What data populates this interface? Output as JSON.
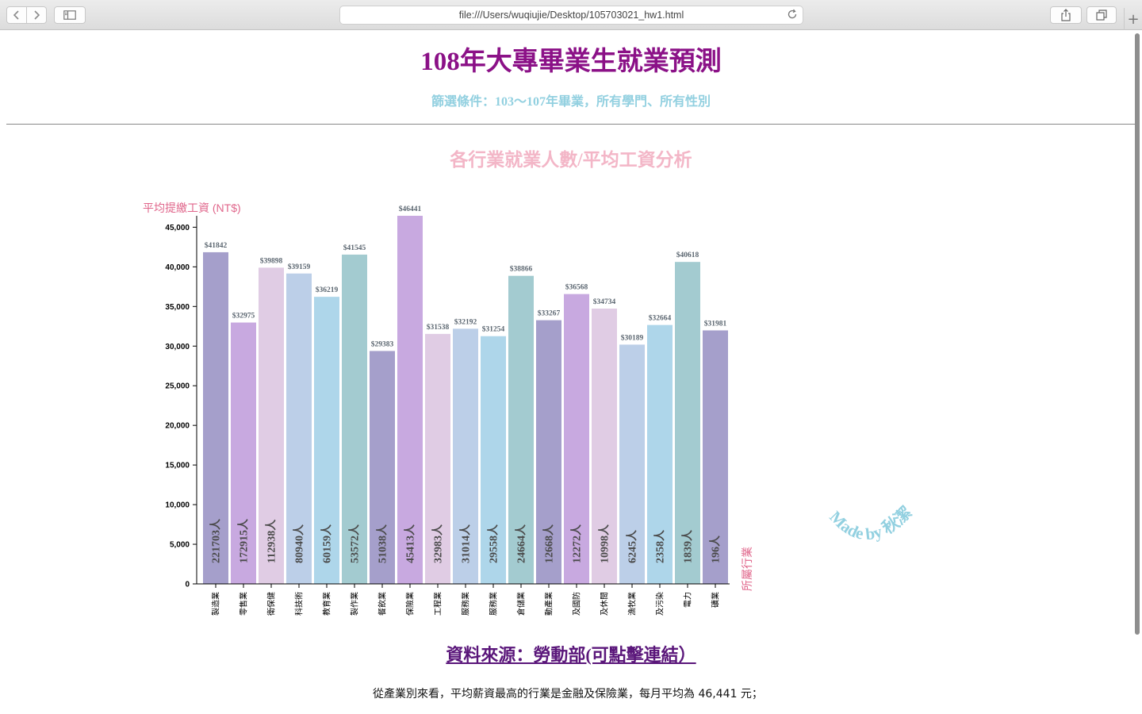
{
  "browser": {
    "url": "file:///Users/wuqiujie/Desktop/105703021_hw1.html"
  },
  "page": {
    "title": "108年大專畢業生就業預測",
    "subtitle": "篩選條件：103～107年畢業，所有學門、所有性別",
    "chart_heading": "各行業就業人數/平均工資分析",
    "watermark": "Made by 秋潔",
    "source_link": "資料來源：勞動部(可點擊連結）",
    "summary": "從產業別來看，平均薪資最高的行業是金融及保險業，每月平均為 46,441 元；"
  },
  "chart_data": {
    "type": "bar",
    "ylabel": "平均提繳工資 (NT$)",
    "xlabel": "所屬行業",
    "ylim": [
      0,
      46441
    ],
    "yticks": [
      0,
      5000,
      10000,
      15000,
      20000,
      25000,
      30000,
      35000,
      40000,
      45000
    ],
    "ytick_labels": [
      "0",
      "5,000",
      "10,000",
      "15,000",
      "20,000",
      "25,000",
      "30,000",
      "35,000",
      "40,000",
      "45,000"
    ],
    "categories": [
      "製造業",
      "零售業",
      "衛保健",
      "科技術",
      "教育業",
      "製作業",
      "餐飲業",
      "保險業",
      "工程業",
      "服務業",
      "服務業",
      "倉儲業",
      "動產業",
      "及國防",
      "及休閒",
      "漁牧業",
      "及污染",
      "電力",
      "礦業"
    ],
    "values": [
      41842,
      32975,
      39898,
      39159,
      36219,
      41545,
      29383,
      46441,
      31538,
      32192,
      31254,
      38866,
      33267,
      36568,
      34734,
      30189,
      32664,
      40618,
      31981
    ],
    "value_labels": [
      "$41842",
      "$32975",
      "$39898",
      "$39159",
      "$36219",
      "$41545",
      "$29383",
      "$46441",
      "$31538",
      "$32192",
      "$31254",
      "$38866",
      "$33267",
      "$36568",
      "$34734",
      "$30189",
      "$32664",
      "$40618",
      "$31981"
    ],
    "headcount_labels": [
      "221703人",
      "172915人",
      "112938人",
      "80940人",
      "60159人",
      "53572人",
      "51038人",
      "45413人",
      "32983人",
      "31014人",
      "29558人",
      "24664人",
      "12668人",
      "12272人",
      "10998人",
      "6245人",
      "2358人",
      "1839人",
      "196人"
    ],
    "colors": [
      "#a59fcb",
      "#c8a9e0",
      "#e0cce4",
      "#bccfe8",
      "#aed6ea",
      "#a3cbd0"
    ],
    "label_color_value": "#5b6670",
    "label_color_count": "#4a4a4a",
    "axis_label_color": "#e0668b"
  }
}
